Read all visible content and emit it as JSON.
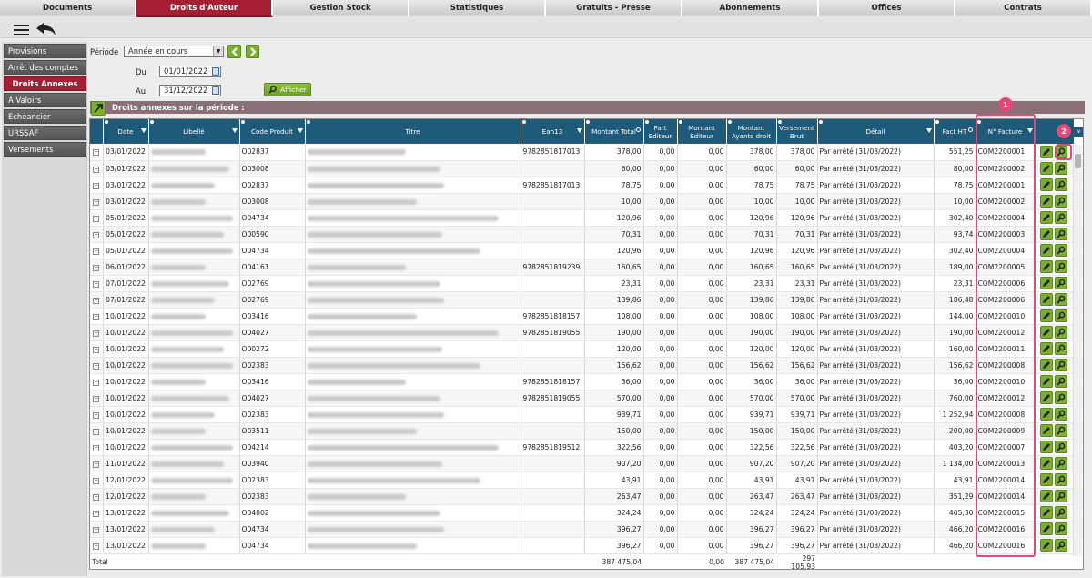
{
  "nav_tabs": [
    {
      "label": "Documents",
      "active": false
    },
    {
      "label": "Droits d'Auteur",
      "active": true
    },
    {
      "label": "Gestion Stock",
      "active": false
    },
    {
      "label": "Statistiques",
      "active": false
    },
    {
      "label": "Gratuits - Presse",
      "active": false
    },
    {
      "label": "Abonnements",
      "active": false
    },
    {
      "label": "Offices",
      "active": false
    },
    {
      "label": "Contrats",
      "active": false
    }
  ],
  "toolbar": {
    "menu_icon": "hamburger-icon",
    "back_icon": "back-arrow-icon"
  },
  "sidebar": {
    "items": [
      {
        "label": "Provisions",
        "active": false
      },
      {
        "label": "Arrêt des comptes",
        "active": false
      },
      {
        "label": "Droits Annexes",
        "active": true
      },
      {
        "label": "A Valoirs",
        "active": false
      },
      {
        "label": "Echéancier",
        "active": false
      },
      {
        "label": "URSSAF",
        "active": false
      },
      {
        "label": "Versements",
        "active": false
      }
    ]
  },
  "filters": {
    "periode_label": "Période",
    "periode_value": "Année en cours",
    "du_label": "Du",
    "du_value": "01/01/2022",
    "au_label": "Au",
    "au_value": "31/12/2022",
    "afficher_label": "Afficher"
  },
  "section_title": "Droits annexes sur la période :",
  "columns": [
    "Date",
    "Libellé",
    "Code Produit",
    "Titre",
    "Ean13",
    "Montant Total",
    "Part Editeur",
    "Montant Editeur",
    "Montant Ayants droit",
    "Versement Brut",
    "Détail",
    "Fact HT",
    "N° Facture"
  ],
  "rows": [
    {
      "date": "03/01/2022",
      "code": "O02837",
      "ean": "9782851817013",
      "total": "378,00",
      "part": "0,00",
      "editeur": "0,00",
      "ayants": "378,00",
      "brut": "378,00",
      "detail": "Par arrêté (31/03/2022)",
      "fact": "551,25",
      "facture": "COM2200001"
    },
    {
      "date": "03/01/2022",
      "code": "O03008",
      "ean": "",
      "total": "60,00",
      "part": "0,00",
      "editeur": "0,00",
      "ayants": "60,00",
      "brut": "60,00",
      "detail": "Par arrêté (31/03/2022)",
      "fact": "80,00",
      "facture": "COM2200002"
    },
    {
      "date": "03/01/2022",
      "code": "O02837",
      "ean": "9782851817013",
      "total": "78,75",
      "part": "0,00",
      "editeur": "0,00",
      "ayants": "78,75",
      "brut": "78,75",
      "detail": "Par arrêté (31/03/2022)",
      "fact": "78,75",
      "facture": "COM2200001"
    },
    {
      "date": "03/01/2022",
      "code": "O03008",
      "ean": "",
      "total": "10,00",
      "part": "0,00",
      "editeur": "0,00",
      "ayants": "10,00",
      "brut": "10,00",
      "detail": "Par arrêté (31/03/2022)",
      "fact": "10,00",
      "facture": "COM2200002"
    },
    {
      "date": "05/01/2022",
      "code": "O04734",
      "ean": "",
      "total": "120,96",
      "part": "0,00",
      "editeur": "0,00",
      "ayants": "120,96",
      "brut": "120,96",
      "detail": "Par arrêté (31/03/2022)",
      "fact": "302,40",
      "facture": "COM2200004"
    },
    {
      "date": "05/01/2022",
      "code": "O00590",
      "ean": "",
      "total": "70,31",
      "part": "0,00",
      "editeur": "0,00",
      "ayants": "70,31",
      "brut": "70,31",
      "detail": "Par arrêté (31/03/2022)",
      "fact": "93,74",
      "facture": "COM2200003"
    },
    {
      "date": "05/01/2022",
      "code": "O04734",
      "ean": "",
      "total": "120,96",
      "part": "0,00",
      "editeur": "0,00",
      "ayants": "120,96",
      "brut": "120,96",
      "detail": "Par arrêté (31/03/2022)",
      "fact": "302,40",
      "facture": "COM2200004"
    },
    {
      "date": "06/01/2022",
      "code": "O04161",
      "ean": "9782851819239",
      "total": "160,65",
      "part": "0,00",
      "editeur": "0,00",
      "ayants": "160,65",
      "brut": "160,65",
      "detail": "Par arrêté (31/03/2022)",
      "fact": "189,00",
      "facture": "COM2200005"
    },
    {
      "date": "07/01/2022",
      "code": "O02769",
      "ean": "",
      "total": "23,31",
      "part": "0,00",
      "editeur": "0,00",
      "ayants": "23,31",
      "brut": "23,31",
      "detail": "Par arrêté (31/03/2022)",
      "fact": "23,31",
      "facture": "COM2200006"
    },
    {
      "date": "07/01/2022",
      "code": "O02769",
      "ean": "",
      "total": "139,86",
      "part": "0,00",
      "editeur": "0,00",
      "ayants": "139,86",
      "brut": "139,86",
      "detail": "Par arrêté (31/03/2022)",
      "fact": "186,48",
      "facture": "COM2200006"
    },
    {
      "date": "10/01/2022",
      "code": "O03416",
      "ean": "9782851818157",
      "total": "108,00",
      "part": "0,00",
      "editeur": "0,00",
      "ayants": "108,00",
      "brut": "108,00",
      "detail": "Par arrêté (31/03/2022)",
      "fact": "144,00",
      "facture": "COM2200010"
    },
    {
      "date": "10/01/2022",
      "code": "O04027",
      "ean": "9782851819055",
      "total": "190,00",
      "part": "0,00",
      "editeur": "0,00",
      "ayants": "190,00",
      "brut": "190,00",
      "detail": "Par arrêté (31/03/2022)",
      "fact": "190,00",
      "facture": "COM2200012"
    },
    {
      "date": "10/01/2022",
      "code": "O00272",
      "ean": "",
      "total": "120,00",
      "part": "0,00",
      "editeur": "0,00",
      "ayants": "120,00",
      "brut": "120,00",
      "detail": "Par arrêté (31/03/2022)",
      "fact": "160,00",
      "facture": "COM2200011"
    },
    {
      "date": "10/01/2022",
      "code": "O02383",
      "ean": "",
      "total": "156,62",
      "part": "0,00",
      "editeur": "0,00",
      "ayants": "156,62",
      "brut": "156,62",
      "detail": "Par arrêté (31/03/2022)",
      "fact": "156,62",
      "facture": "COM2200008"
    },
    {
      "date": "10/01/2022",
      "code": "O03416",
      "ean": "9782851818157",
      "total": "36,00",
      "part": "0,00",
      "editeur": "0,00",
      "ayants": "36,00",
      "brut": "36,00",
      "detail": "Par arrêté (31/03/2022)",
      "fact": "36,00",
      "facture": "COM2200010"
    },
    {
      "date": "10/01/2022",
      "code": "O04027",
      "ean": "9782851819055",
      "total": "570,00",
      "part": "0,00",
      "editeur": "0,00",
      "ayants": "570,00",
      "brut": "570,00",
      "detail": "Par arrêté (31/03/2022)",
      "fact": "760,00",
      "facture": "COM2200012"
    },
    {
      "date": "10/01/2022",
      "code": "O02383",
      "ean": "",
      "total": "939,71",
      "part": "0,00",
      "editeur": "0,00",
      "ayants": "939,71",
      "brut": "939,71",
      "detail": "Par arrêté (31/03/2022)",
      "fact": "1 252,94",
      "facture": "COM2200008"
    },
    {
      "date": "10/01/2022",
      "code": "O03511",
      "ean": "",
      "total": "150,00",
      "part": "0,00",
      "editeur": "0,00",
      "ayants": "150,00",
      "brut": "150,00",
      "detail": "Par arrêté (31/03/2022)",
      "fact": "200,00",
      "facture": "COM2200009"
    },
    {
      "date": "10/01/2022",
      "code": "O04214",
      "ean": "9782851819512",
      "total": "322,56",
      "part": "0,00",
      "editeur": "0,00",
      "ayants": "322,56",
      "brut": "322,56",
      "detail": "Par arrêté (31/03/2022)",
      "fact": "403,20",
      "facture": "COM2200007"
    },
    {
      "date": "11/01/2022",
      "code": "O03940",
      "ean": "",
      "total": "907,20",
      "part": "0,00",
      "editeur": "0,00",
      "ayants": "907,20",
      "brut": "907,20",
      "detail": "Par arrêté (31/03/2022)",
      "fact": "1 134,00",
      "facture": "COM2200013"
    },
    {
      "date": "12/01/2022",
      "code": "O02383",
      "ean": "",
      "total": "43,91",
      "part": "0,00",
      "editeur": "0,00",
      "ayants": "43,91",
      "brut": "43,91",
      "detail": "Par arrêté (31/03/2022)",
      "fact": "43,91",
      "facture": "COM2200014"
    },
    {
      "date": "12/01/2022",
      "code": "O02383",
      "ean": "",
      "total": "263,47",
      "part": "0,00",
      "editeur": "0,00",
      "ayants": "263,47",
      "brut": "263,47",
      "detail": "Par arrêté (31/03/2022)",
      "fact": "351,29",
      "facture": "COM2200014"
    },
    {
      "date": "13/01/2022",
      "code": "O04802",
      "ean": "",
      "total": "324,24",
      "part": "0,00",
      "editeur": "0,00",
      "ayants": "324,24",
      "brut": "324,24",
      "detail": "Par arrêté (31/03/2022)",
      "fact": "405,30",
      "facture": "COM2200015"
    },
    {
      "date": "13/01/2022",
      "code": "O04734",
      "ean": "",
      "total": "396,27",
      "part": "0,00",
      "editeur": "0,00",
      "ayants": "396,27",
      "brut": "396,27",
      "detail": "Par arrêté (31/03/2022)",
      "fact": "466,20",
      "facture": "COM2200016"
    },
    {
      "date": "13/01/2022",
      "code": "O04734",
      "ean": "",
      "total": "396,27",
      "part": "0,00",
      "editeur": "0,00",
      "ayants": "396,27",
      "brut": "396,27",
      "detail": "Par arrêté (31/03/2022)",
      "fact": "466,20",
      "facture": "COM2200016"
    }
  ],
  "totals": {
    "label": "Total",
    "total": "387 475,04",
    "editeur": "0,00",
    "ayants": "387 475,04",
    "brut": "297 105,93"
  },
  "annotations": {
    "badge1": "1",
    "badge2": "2",
    "color": "#e5477a"
  }
}
